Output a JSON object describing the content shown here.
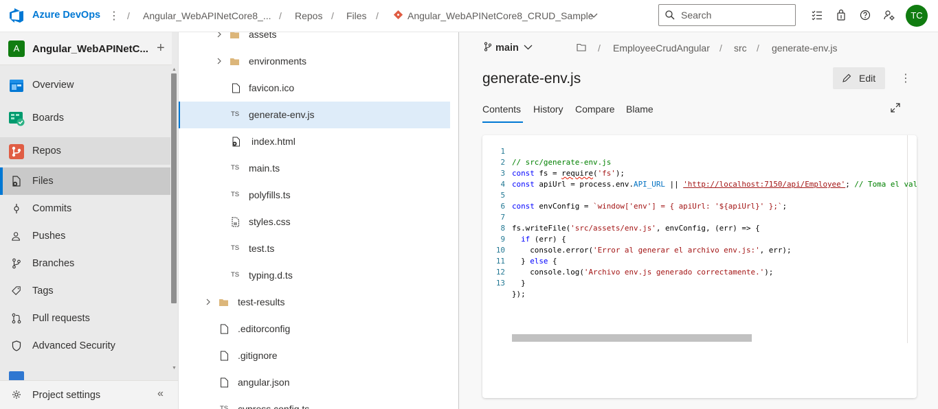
{
  "topbar": {
    "brand": "Azure DevOps",
    "breadcrumbs": [
      "Angular_WebAPINetCore8_...",
      "Repos",
      "Files",
      "Angular_WebAPINetCore8_CRUD_Sample"
    ],
    "search_placeholder": "Search",
    "avatar_initials": "TC",
    "accent_color": "#0078d4",
    "avatar_color": "#107c10"
  },
  "project": {
    "badge": "A",
    "name": "Angular_WebAPINetC..."
  },
  "nav": {
    "items": [
      {
        "label": "Overview",
        "icon": "overview-icon"
      },
      {
        "label": "Boards",
        "icon": "boards-icon"
      },
      {
        "label": "Repos",
        "icon": "repos-icon"
      },
      {
        "label": "Files",
        "icon": "files-icon",
        "selected": true
      },
      {
        "label": "Commits",
        "icon": "commits-icon"
      },
      {
        "label": "Pushes",
        "icon": "pushes-icon"
      },
      {
        "label": "Branches",
        "icon": "branches-icon"
      },
      {
        "label": "Tags",
        "icon": "tags-icon"
      },
      {
        "label": "Pull requests",
        "icon": "pull-requests-icon"
      },
      {
        "label": "Advanced Security",
        "icon": "advanced-security-icon"
      }
    ],
    "settings_label": "Project settings"
  },
  "tree": {
    "items": [
      {
        "name": "assets",
        "type": "folder"
      },
      {
        "name": "environments",
        "type": "folder"
      },
      {
        "name": "favicon.ico",
        "type": "file"
      },
      {
        "name": "generate-env.js",
        "type": "ts",
        "selected": true
      },
      {
        "name": "index.html",
        "type": "html"
      },
      {
        "name": "main.ts",
        "type": "ts"
      },
      {
        "name": "polyfills.ts",
        "type": "ts"
      },
      {
        "name": "styles.css",
        "type": "css"
      },
      {
        "name": "test.ts",
        "type": "ts"
      },
      {
        "name": "typing.d.ts",
        "type": "ts"
      },
      {
        "name": "test-results",
        "type": "folder"
      },
      {
        "name": ".editorconfig",
        "type": "file"
      },
      {
        "name": ".gitignore",
        "type": "file"
      },
      {
        "name": "angular.json",
        "type": "file"
      },
      {
        "name": "cypress.config.ts",
        "type": "ts"
      }
    ],
    "ts_badge": "TS"
  },
  "main": {
    "branch": "main",
    "path": [
      "EmployeeCrudAngular",
      "src",
      "generate-env.js"
    ],
    "file_title": "generate-env.js",
    "edit_label": "Edit",
    "tabs": [
      "Contents",
      "History",
      "Compare",
      "Blame"
    ],
    "active_tab": "Contents"
  },
  "code": {
    "line_numbers": [
      "1",
      "2",
      "3",
      "4",
      "5",
      "6",
      "7",
      "8",
      "9",
      "10",
      "11",
      "12",
      "13"
    ],
    "l1": "// src/generate-env.js",
    "l2_kw": "const",
    "l2_a": " fs = ",
    "l2_req": "require",
    "l2_b": "(",
    "l2_str": "'fs'",
    "l2_c": ");",
    "l3_kw": "const",
    "l3_a": " apiUrl = process.env.",
    "l3_prop": "API_URL",
    "l3_b": " || ",
    "l3_url": "'http://localhost:7150/api/Employee'",
    "l3_c": "; ",
    "l3_com": "// Toma el valor",
    "l5_kw": "const",
    "l5_a": " envConfig = ",
    "l5_str": "`window['env'] = { apiUrl: '${apiUrl}' };`",
    "l5_b": ";",
    "l7_a": "fs.writeFile(",
    "l7_str": "'src/assets/env.js'",
    "l7_b": ", envConfig, (err) => {",
    "l8_kw": "  if",
    "l8_a": " (err) {",
    "l9_a": "    console.error(",
    "l9_str": "'Error al generar el archivo env.js:'",
    "l9_b": ", err);",
    "l10_a": "  } ",
    "l10_kw": "else",
    "l10_b": " {",
    "l11_a": "    console.log(",
    "l11_str": "'Archivo env.js generado correctamente.'",
    "l11_b": ");",
    "l12": "  }",
    "l13": "});"
  }
}
